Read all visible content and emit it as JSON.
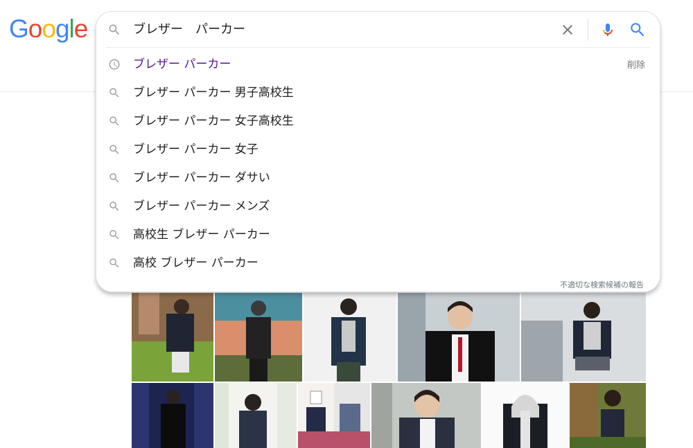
{
  "logo": {
    "letters": [
      "G",
      "o",
      "o",
      "g",
      "l",
      "e"
    ],
    "colors": [
      "#4285F4",
      "#EA4335",
      "#FBBC05",
      "#4285F4",
      "#34A853",
      "#EA4335"
    ]
  },
  "search": {
    "query": "ブレザー　パーカー",
    "icons": {
      "left": "search-icon",
      "clear": "close-icon",
      "voice": "mic-icon",
      "submit": "search-icon"
    }
  },
  "suggestions": [
    {
      "text": "ブレザー パーカー",
      "icon": "history-icon",
      "visited": true,
      "action": "削除"
    },
    {
      "text": "ブレザー パーカー 男子高校生",
      "icon": "search-icon"
    },
    {
      "text": "ブレザー パーカー 女子高校生",
      "icon": "search-icon"
    },
    {
      "text": "ブレザー パーカー 女子",
      "icon": "search-icon"
    },
    {
      "text": "ブレザー パーカー ダサい",
      "icon": "search-icon"
    },
    {
      "text": "ブレザー パーカー メンズ",
      "icon": "search-icon"
    },
    {
      "text": "高校生 ブレザー パーカー",
      "icon": "search-icon"
    },
    {
      "text": "高校 ブレザー パーカー",
      "icon": "search-icon"
    }
  ],
  "report_link": "不適切な検索候補の報告",
  "colors": {
    "accent": "#4285F4",
    "visited": "#52188c",
    "muted": "#70757a"
  }
}
